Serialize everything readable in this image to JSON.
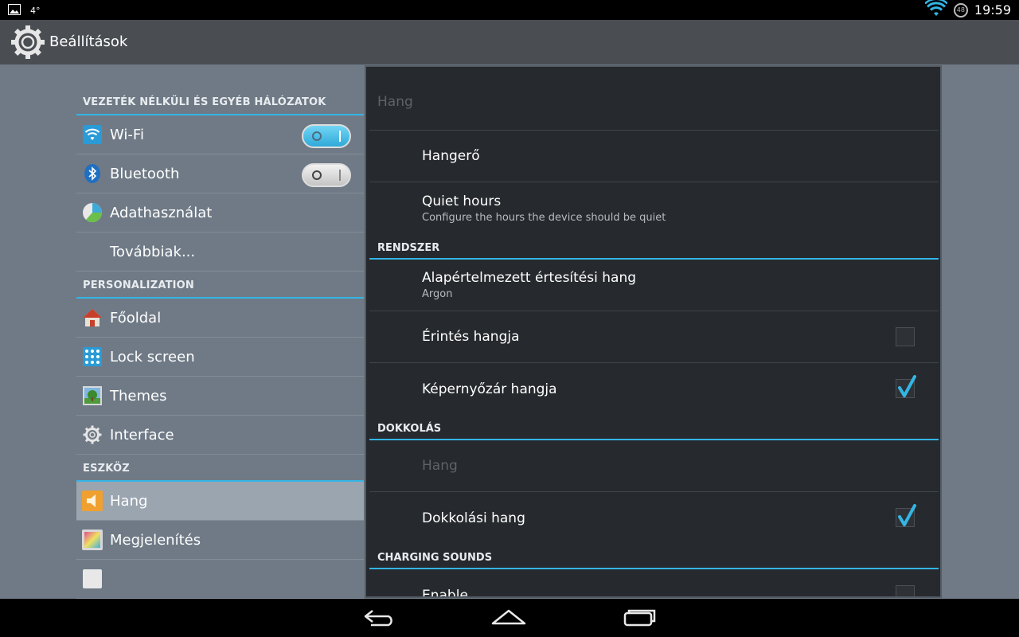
{
  "status_bar": {
    "clock": "19:59",
    "temperature": "4°",
    "battery_level": "48",
    "icons": [
      "image-notification-icon",
      "wifi-icon",
      "battery-icon"
    ]
  },
  "action_bar": {
    "title": "Beállítások",
    "icon": "settings-gear-icon"
  },
  "sidebar": {
    "sections": [
      {
        "header": "VEZETÉK NÉLKÜLI ÉS EGYÉB HÁLÓZATOK",
        "items": [
          {
            "label": "Wi-Fi",
            "icon": "wifi-icon",
            "toggle": "on"
          },
          {
            "label": "Bluetooth",
            "icon": "bluetooth-icon",
            "toggle": "off"
          },
          {
            "label": "Adathasználat",
            "icon": "data-usage-icon"
          },
          {
            "label": "Továbbiak..."
          }
        ]
      },
      {
        "header": "PERSONALIZATION",
        "items": [
          {
            "label": "Főoldal",
            "icon": "home-icon"
          },
          {
            "label": "Lock screen",
            "icon": "lock-screen-icon"
          },
          {
            "label": "Themes",
            "icon": "themes-icon"
          },
          {
            "label": "Interface",
            "icon": "interface-gear-icon"
          }
        ]
      },
      {
        "header": "ESZKÖZ",
        "items": [
          {
            "label": "Hang",
            "icon": "sound-icon",
            "selected": true
          },
          {
            "label": "Megjelenítés",
            "icon": "display-icon"
          }
        ]
      }
    ]
  },
  "detail": {
    "title": "Hang",
    "items_top": [
      {
        "title": "Hangerő"
      },
      {
        "title": "Quiet hours",
        "summary": "Configure the hours the device should be quiet"
      }
    ],
    "rendszer": {
      "header": "RENDSZER",
      "items": [
        {
          "title": "Alapértelmezett értesítési hang",
          "summary": "Argon"
        },
        {
          "title": "Érintés hangja",
          "checked": false
        },
        {
          "title": "Képernyőzár hangja",
          "checked": true
        }
      ]
    },
    "dokkolas": {
      "header": "DOKKOLÁS",
      "items": [
        {
          "title": "Hang",
          "disabled": true
        },
        {
          "title": "Dokkolási hang",
          "checked": true
        }
      ]
    },
    "charging": {
      "header": "CHARGING SOUNDS",
      "items": [
        {
          "title": "Enable",
          "checked": false
        }
      ]
    }
  },
  "nav_bar": {
    "icons": [
      "back-icon",
      "home-icon",
      "recent-apps-icon"
    ]
  },
  "colors": {
    "accent": "#33b5e5",
    "actionbar_bg": "#4a4e53",
    "sidebar_bg": "#6f7a86",
    "detail_bg": "#26292d"
  }
}
